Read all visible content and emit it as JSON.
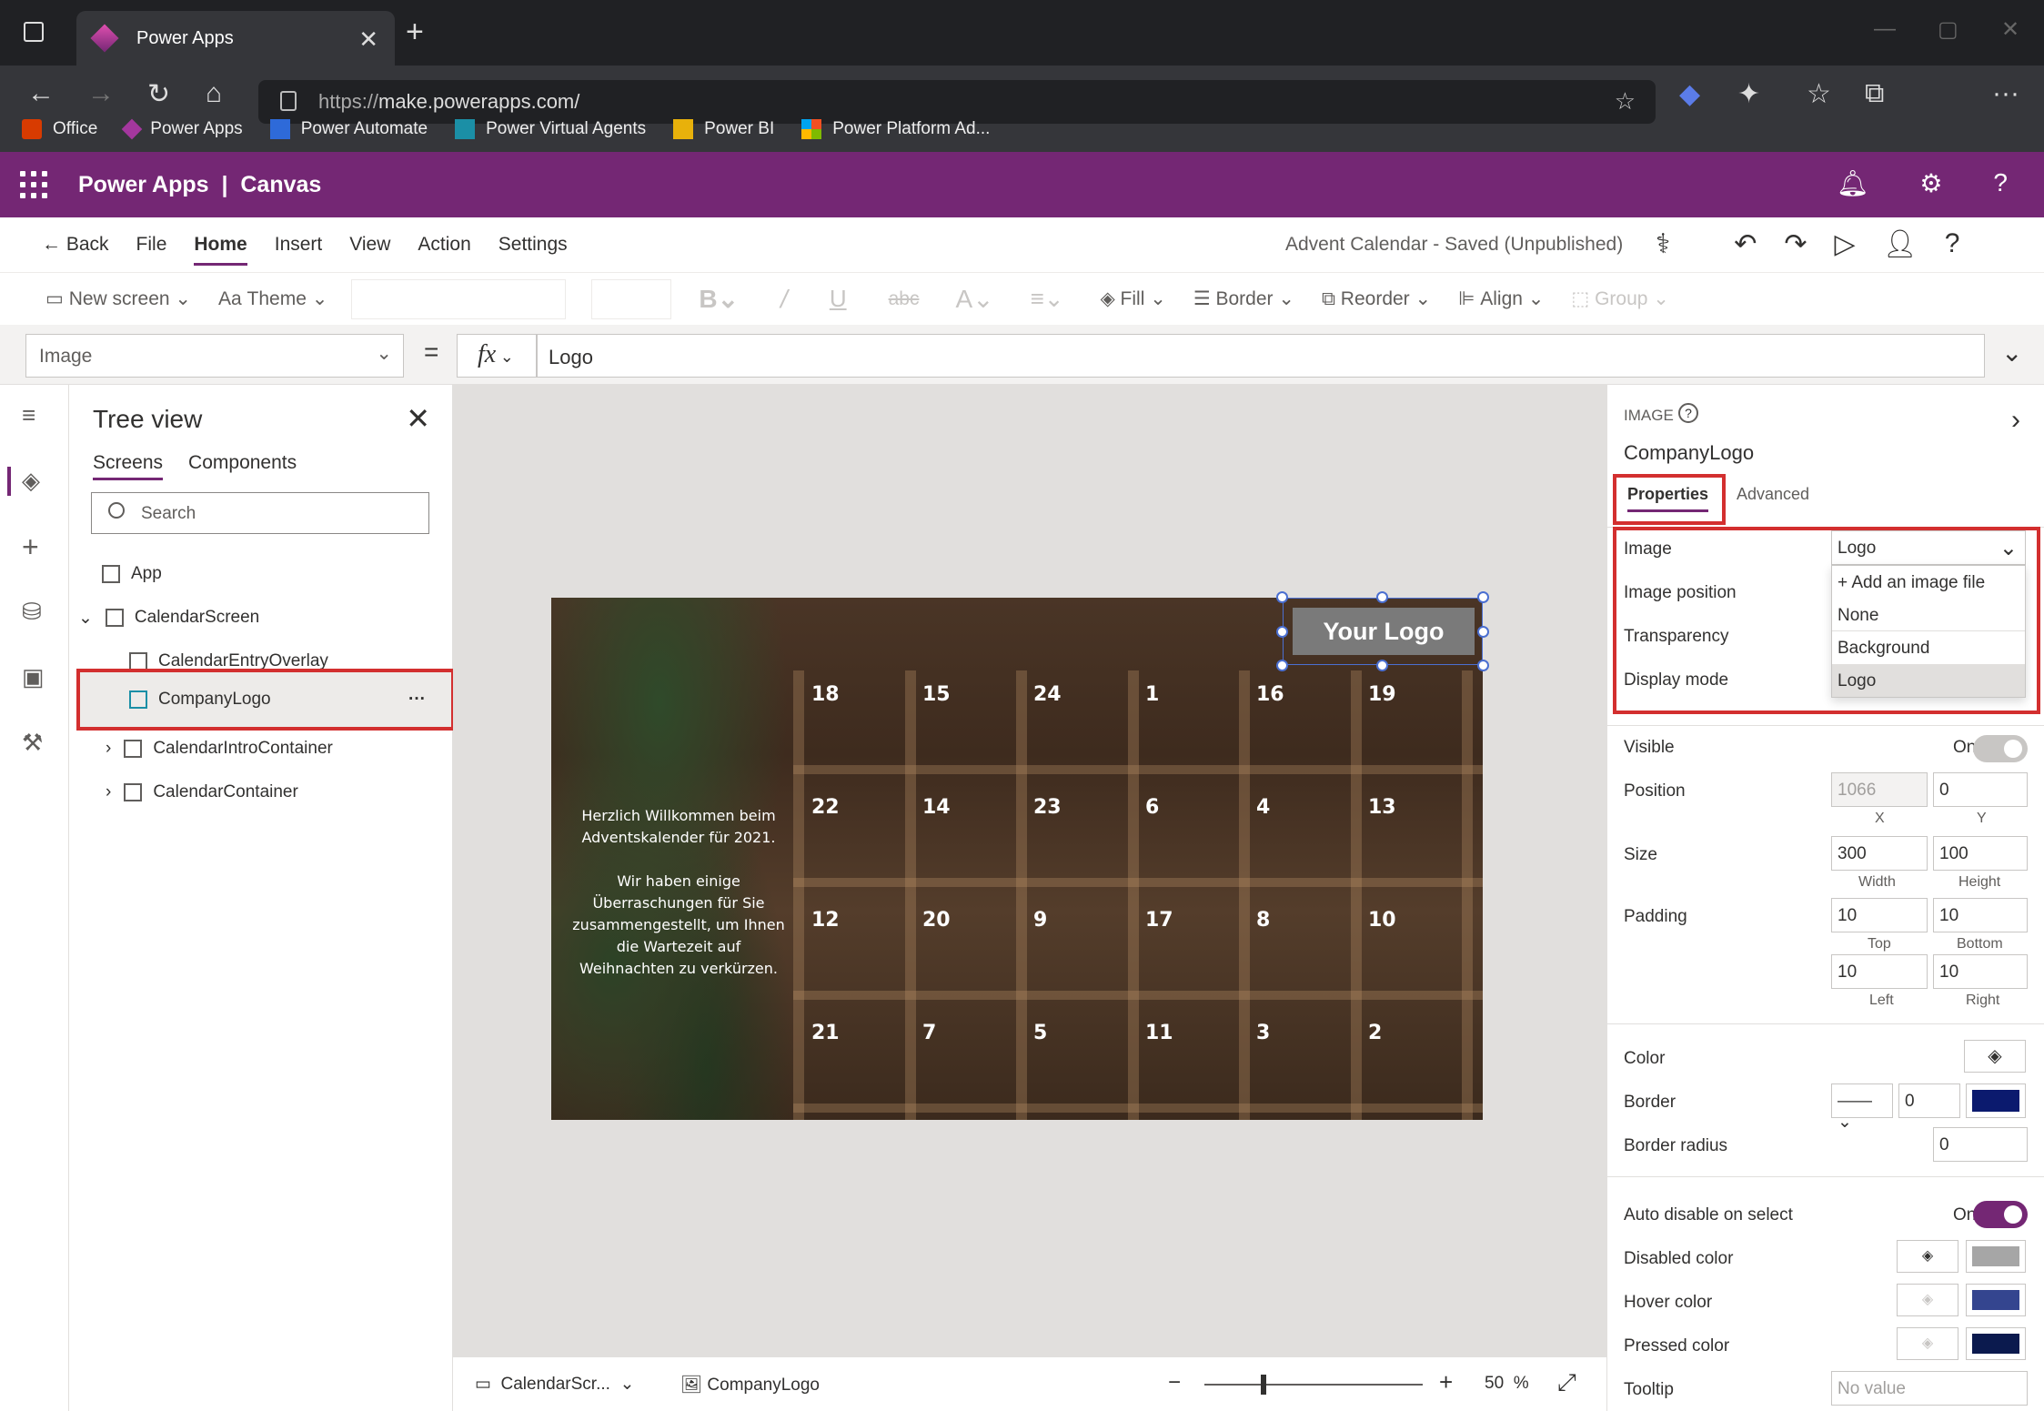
{
  "browser": {
    "tab_title": "Power Apps",
    "url_scheme": "https://",
    "url_host": "make.powerapps.com/",
    "bookmarks": [
      "Office",
      "Power Apps",
      "Power Automate",
      "Power Virtual Agents",
      "Power BI",
      "Power Platform Ad..."
    ]
  },
  "app_header": {
    "brand": "Power Apps",
    "separator": "|",
    "mode": "Canvas"
  },
  "menu": {
    "back": "Back",
    "items": [
      "File",
      "Home",
      "Insert",
      "View",
      "Action",
      "Settings"
    ],
    "active": "Home",
    "save_status": "Advent Calendar - Saved (Unpublished)"
  },
  "toolbar": {
    "new_screen": "New screen",
    "theme": "Theme",
    "fill": "Fill",
    "border": "Border",
    "reorder": "Reorder",
    "align": "Align",
    "group": "Group"
  },
  "formula_bar": {
    "property": "Image",
    "equals": "=",
    "fx": "fx",
    "formula": "Logo"
  },
  "tree_view": {
    "title": "Tree view",
    "tabs": [
      "Screens",
      "Components"
    ],
    "search_placeholder": "Search",
    "nodes": [
      {
        "label": "App"
      },
      {
        "label": "CalendarScreen"
      },
      {
        "label": "CalendarEntryOverlay"
      },
      {
        "label": "CompanyLogo"
      },
      {
        "label": "CalendarIntroContainer"
      },
      {
        "label": "CalendarContainer"
      }
    ],
    "more": "···"
  },
  "calendar": {
    "rows": [
      [
        "18",
        "15",
        "24",
        "1",
        "16",
        "19"
      ],
      [
        "22",
        "14",
        "23",
        "6",
        "4",
        "13"
      ],
      [
        "12",
        "20",
        "9",
        "17",
        "8",
        "10"
      ],
      [
        "21",
        "7",
        "5",
        "11",
        "3",
        "2"
      ]
    ],
    "intro_line1": "Herzlich Willkommen beim Adventskalender für 2021.",
    "intro_line2": "Wir haben einige Überraschungen für Sie zusammengestellt, um Ihnen die Wartezeit auf Weihnachten zu verkürzen.",
    "logo_text": "Your Logo"
  },
  "status_bar": {
    "screen": "CalendarScr...",
    "control": "CompanyLogo",
    "zoom": "50",
    "zoom_unit": "%"
  },
  "properties": {
    "type": "IMAGE",
    "name": "CompanyLogo",
    "tabs": [
      "Properties",
      "Advanced"
    ],
    "image_label": "Image",
    "image_value": "Logo",
    "image_position_label": "Image position",
    "transparency_label": "Transparency",
    "display_mode_label": "Display mode",
    "dropdown_options": [
      "Add an image file",
      "None",
      "Background",
      "Logo"
    ],
    "visible_label": "Visible",
    "visible_value": "On",
    "position_label": "Position",
    "position_x": "1066",
    "position_y": "0",
    "x_label": "X",
    "y_label": "Y",
    "size_label": "Size",
    "width": "300",
    "height": "100",
    "width_label": "Width",
    "height_label": "Height",
    "padding_label": "Padding",
    "pad_top": "10",
    "pad_bottom": "10",
    "pad_left": "10",
    "pad_right": "10",
    "top_label": "Top",
    "bottom_label": "Bottom",
    "left_label": "Left",
    "right_label": "Right",
    "color_label": "Color",
    "border_label": "Border",
    "border_width": "0",
    "border_radius_label": "Border radius",
    "border_radius": "0",
    "auto_disable_label": "Auto disable on select",
    "auto_disable_value": "On",
    "disabled_color_label": "Disabled color",
    "hover_color_label": "Hover color",
    "pressed_color_label": "Pressed color",
    "tooltip_label": "Tooltip",
    "tooltip_placeholder": "No value"
  },
  "colors": {
    "accent": "#742774",
    "border_color": "#0b1a6e",
    "disabled": "#a6a6a6",
    "hover": "#34458f",
    "pressed": "#0b1a4e",
    "highlight": "#d32f2f"
  }
}
